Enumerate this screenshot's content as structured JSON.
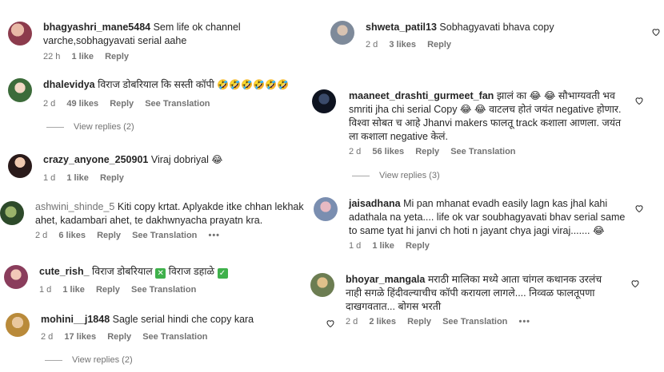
{
  "labels": {
    "reply": "Reply",
    "see_translation": "See Translation",
    "more": "•••"
  },
  "left_comments": [
    {
      "username": "bhagyashri_mane5484",
      "text": "Sem life ok channel varche,sobhagyavati serial aahe",
      "time": "22 h",
      "likes": "1 like"
    },
    {
      "username": "dhalevidya",
      "text": "विराज डोबरियाल कि सस्ती कॉपी",
      "emojis": "🤣🤣🤣🤣🤣🤣",
      "time": "2 d",
      "likes": "49 likes",
      "view_replies": "View replies (2)"
    },
    {
      "username": "crazy_anyone_250901",
      "text": "Viraj dobriyal",
      "emojis": "😂",
      "time": "1 d",
      "likes": "1 like"
    },
    {
      "username": "ashwini_shinde_5",
      "text": "Kiti copy krtat. Aplyakde itke chhan lekhak ahet, kadambari ahet, te dakhwnyacha prayatn kra.",
      "time": "2 d",
      "likes": "6 likes"
    },
    {
      "username": "cute_rish_",
      "text": "विराज डोबरियाल",
      "check_text": "✕",
      "text2": "विराज डहाळे",
      "check2": "✓",
      "time": "1 d",
      "likes": "1 like"
    },
    {
      "username": "mohini__j1848",
      "text": "Sagle serial hindi che copy kara",
      "time": "2 d",
      "likes": "17 likes",
      "view_replies": "View replies (2)"
    }
  ],
  "right_comments": [
    {
      "username": "shweta_patil13",
      "text": "Sobhagyavati bhava copy",
      "time": "2 d",
      "likes": "3 likes"
    },
    {
      "username": "maaneet_drashti_gurmeet_fan",
      "text_lines": [
        "झालं का 😂 😂 सौभाग्यवती भव",
        "smriti jha chi serial Copy 😂 😂 वाटलच होतं जयंत negative होणार.",
        "विश्वा सोबत च आहे Jhanvi makers फालतू track कशाला आणला. जयंत",
        "ला कशाला negative केलं."
      ],
      "time": "2 d",
      "likes": "56 likes",
      "view_replies": "View replies (3)"
    },
    {
      "username": "jaisadhana",
      "text_lines": [
        "Mi pan mhanat evadh easily lagn kas jhal kahi",
        "adathala na yeta.... life ok var soubhagyavati bhav serial same",
        "to same tyat hi janvi ch hoti n jayant chya jagi viraj....... 😂"
      ],
      "time": "1 d",
      "likes": "1 like"
    },
    {
      "username": "bhoyar_mangala",
      "text_lines": [
        "मराठी मालिका मध्ये आता चांगल कथानक उरलंच",
        "नाही सगळे हिंदीवल्याचीच कॉपी करायला लागले.... निव्वळ फालतूपणा",
        "दाखगवतात... बोगस भरती"
      ],
      "time": "2 d",
      "likes": "2 likes"
    }
  ],
  "colors": {
    "text": "#262626",
    "muted": "#737373",
    "check_green": "#3fb14b"
  },
  "icons": [
    "heart-icon",
    "more-dots-icon",
    "check-icon"
  ]
}
